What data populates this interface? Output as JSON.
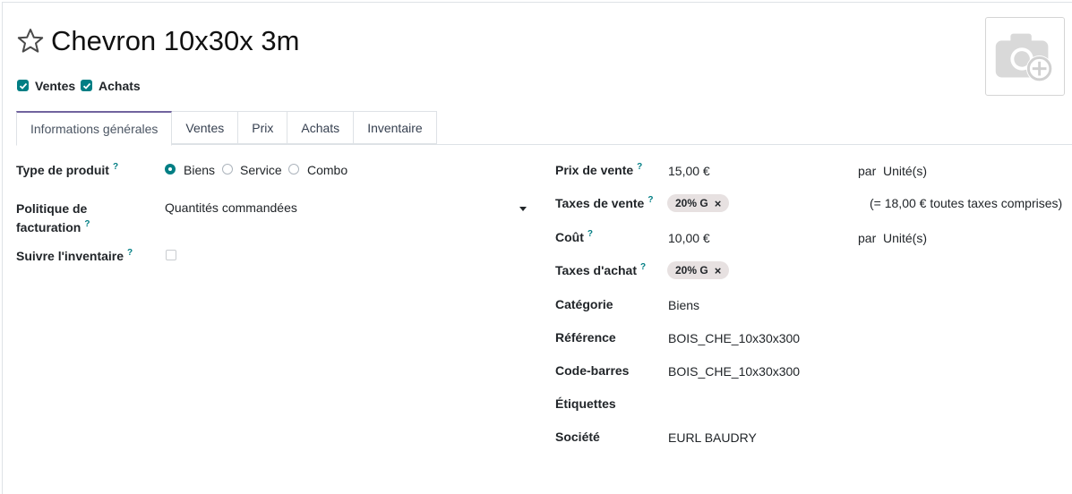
{
  "product": {
    "title": "Chevron 10x30x 3m",
    "checks": [
      {
        "label": "Ventes",
        "checked": true
      },
      {
        "label": "Achats",
        "checked": true
      }
    ]
  },
  "tabs": [
    {
      "label": "Informations générales",
      "active": true
    },
    {
      "label": "Ventes",
      "active": false
    },
    {
      "label": "Prix",
      "active": false
    },
    {
      "label": "Achats",
      "active": false
    },
    {
      "label": "Inventaire",
      "active": false
    }
  ],
  "left": {
    "type_label": "Type de produit",
    "type_options": [
      "Biens",
      "Service",
      "Combo"
    ],
    "type_selected": "Biens",
    "invoice_label_line1": "Politique de",
    "invoice_label_line2": "facturation",
    "invoice_value": "Quantités commandées",
    "track_label": "Suivre l'inventaire",
    "track_checked": false
  },
  "right": {
    "sale_price_label": "Prix de vente",
    "sale_price_value": "15,00 €",
    "sale_price_unit_prefix": "par",
    "sale_price_unit": "Unité(s)",
    "sale_tax_label": "Taxes de vente",
    "sale_tax_tag": "20% G",
    "sale_tax_incl": "(= 18,00 € toutes taxes comprises)",
    "cost_label": "Coût",
    "cost_value": "10,00 €",
    "cost_unit_prefix": "par",
    "cost_unit": "Unité(s)",
    "purchase_tax_label": "Taxes d'achat",
    "purchase_tax_tag": "20% G",
    "category_label": "Catégorie",
    "category_value": "Biens",
    "reference_label": "Référence",
    "reference_value": "BOIS_CHE_10x30x300",
    "barcode_label": "Code-barres",
    "barcode_value": "BOIS_CHE_10x30x300",
    "tags_label": "Étiquettes",
    "company_label": "Société",
    "company_value": "EURL BAUDRY"
  },
  "help_mark": "?",
  "tag_remove": "×",
  "colors": {
    "accent": "#017e84",
    "tab_active": "#71639e",
    "tag_bg": "#e7e1e1"
  }
}
